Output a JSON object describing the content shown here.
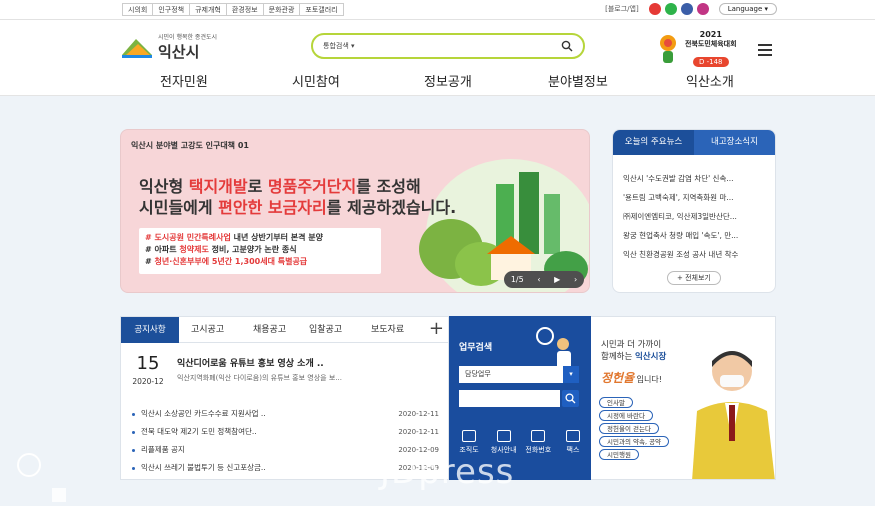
{
  "topbar": {
    "links": [
      "시의회",
      "인구정책",
      "규제개혁",
      "환경정보",
      "문화관광",
      "포토갤러리"
    ],
    "blog_label": "[블로그/앱]",
    "language_label": "Language"
  },
  "header": {
    "logo_sub": "시민이 행복한 종견도시",
    "logo_main": "익산시",
    "search_scope": "통합검색",
    "search_placeholder": "",
    "event_year": "2021",
    "event_title": "전북도민체육대회",
    "event_dday": "D -148"
  },
  "nav": [
    "전자민원",
    "시민참여",
    "정보공개",
    "분야별정보",
    "익산소개"
  ],
  "banner": {
    "tag": "익산시 분야별 고강도 인구대책 01",
    "line1_a": "익산형 ",
    "line1_hl1": "택지개발",
    "line1_b": "로 ",
    "line1_hl2": "명품주거단지",
    "line1_c": "를 조성해",
    "line2_a": "시민들에게 ",
    "line2_hl": "편안한 보금자리",
    "line2_b": "를 제공하겠습니다.",
    "bullet1_hl": "# 도시공원 민간특례사업",
    "bullet1_rest": " 내년 상반기부터 본격 분양",
    "bullet2_a": "# 아파트 ",
    "bullet2_hl": "청약제도",
    "bullet2_b": " 정비, 고분양가 논란 종식",
    "bullet3_a": "# ",
    "bullet3_hl": "청년·신혼부부에 5년간 1,300세대 특별공급",
    "counter": "1/5"
  },
  "news": {
    "tab_active": "오늘의 주요뉴스",
    "tab_other": "내고장소식지",
    "items": [
      "익산시 '수도권발 감염 차단' 신속...",
      "'용트림 고백숙제', 지역축화원 마...",
      "㈜제이엔엠티코, 익산제3일반산단...",
      "왕궁 현업축사 청량 매입 '속도', 만...",
      "익산 친환경공원 조성 공사 내년 착수"
    ],
    "more_label": "+ 전체보기"
  },
  "notice": {
    "tabs": [
      "공지사항",
      "고시공고",
      "채용공고",
      "입찰공고",
      "보도자료"
    ],
    "featured": {
      "day": "15",
      "ym": "2020-12",
      "title": "익산디어로움 유튜브 홍보 영상 소개 ..",
      "desc": "익산지역화폐(익산 다이로움)의 유튜브 홍보 영상을 보..."
    },
    "items": [
      {
        "title": "익산시 소상공인 카드수수료 지원사업 ..",
        "date": "2020-12-11"
      },
      {
        "title": "전북 대도약 제2기 도민 정책참여단..",
        "date": "2020-12-11"
      },
      {
        "title": "리플제품 공지",
        "date": "2020-12-09"
      },
      {
        "title": "익산시 쓰레기 불법투기 등 신고포상금..",
        "date": "2020-12-09"
      }
    ]
  },
  "work": {
    "title": "업무검색",
    "select_value": "담당업무",
    "icons": [
      "조직도",
      "청사안내",
      "전화번호",
      "팩스"
    ]
  },
  "mayor": {
    "line1": "시민과 더 가까이",
    "line2_a": "함께하는 ",
    "line2_b": "익산시장",
    "name": "정헌율",
    "name_suffix": " 입니다!",
    "links": [
      "인사말",
      "시정에 바란다",
      "정헌율이 걷는다",
      "시민과의 약속, 공약",
      "시민행원"
    ]
  },
  "watermark": "JDpress"
}
